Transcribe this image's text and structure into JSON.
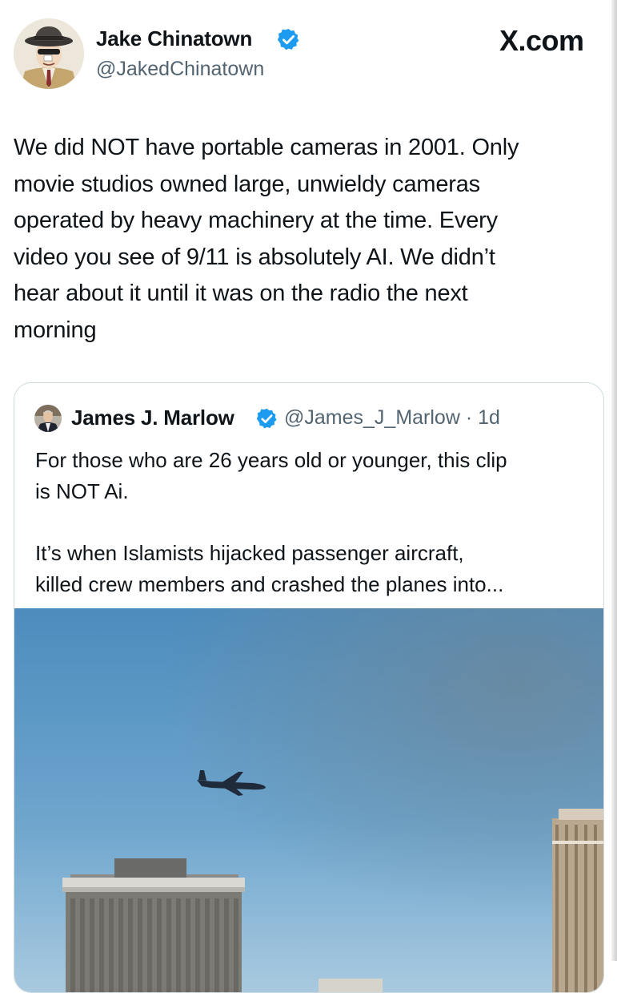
{
  "site_label": "X.com",
  "tweet": {
    "author": {
      "name": "Jake Chinatown",
      "handle": "@JakedChinatown",
      "verified": true,
      "avatar_icon": "cartoon-detective-avatar"
    },
    "text": "We did NOT have portable cameras in 2001. Only\nmovie studios owned large, unwieldy cameras\noperated by heavy machinery at the time. Every\nvideo you see of 9/11 is absolutely AI. We didn’t\nhear about it until it was on the radio the next\nmorning"
  },
  "quoted_tweet": {
    "author": {
      "name": "James J. Marlow",
      "verified": true,
      "avatar_icon": "man-in-suit-avatar"
    },
    "meta": "@James_J_Marlow · 1d",
    "text": "For those who are 26 years old or younger, this clip\nis NOT Ai.\n\nIt’s when Islamists hijacked passenger aircraft,\nkilled crew members and crashed the planes into...",
    "media": {
      "type": "video-still",
      "description_icon": "airplane-over-skyline-image"
    }
  },
  "colors": {
    "text_primary": "#0f1419",
    "text_secondary": "#536471",
    "verified_blue": "#1d9bf0",
    "card_border": "#cfd9de",
    "sky_top": "#4f8fbf",
    "sky_bottom": "#aacbe2"
  }
}
